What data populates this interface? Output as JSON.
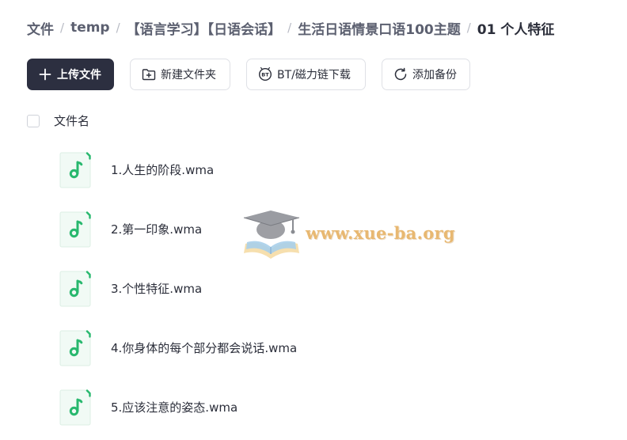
{
  "breadcrumb": {
    "items": [
      "文件",
      "temp",
      "【语言学习】【日语会话】",
      "生活日语情景口语100主题",
      "01 个人特征"
    ],
    "separator": "/"
  },
  "toolbar": {
    "upload_label": "上传文件",
    "new_folder_label": "新建文件夹",
    "bt_label": "BT/磁力链下载",
    "backup_label": "添加备份"
  },
  "file_list": {
    "header_label": "文件名",
    "files": [
      {
        "name": "1.人生的阶段.wma"
      },
      {
        "name": "2.第一印象.wma"
      },
      {
        "name": "3.个性特征.wma"
      },
      {
        "name": "4.你身体的每个部分都会说话.wma"
      },
      {
        "name": "5.应该注意的姿态.wma"
      }
    ]
  },
  "watermark": {
    "text": "www.xue-ba.org"
  },
  "colors": {
    "primary_button": "#2c2f40",
    "file_icon_accent": "#28b86e",
    "file_icon_bg": "#f1faf5",
    "watermark": "#e8b871"
  },
  "icons": {
    "upload": "plus-icon",
    "new_folder": "folder-plus-icon",
    "bt": "bt-icon",
    "backup": "refresh-icon",
    "file": "music-file-icon"
  }
}
